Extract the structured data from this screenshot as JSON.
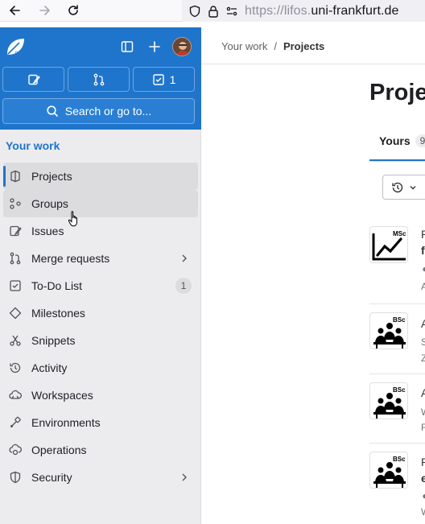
{
  "browser": {
    "url_prefix": "https://lifos.",
    "url_domain": "uni-frankfurt.de"
  },
  "sidebar": {
    "quick_actions": [
      {
        "name": "issues",
        "count": ""
      },
      {
        "name": "merge-requests",
        "count": ""
      },
      {
        "name": "todos",
        "count": "1"
      }
    ],
    "search_placeholder": "Search or go to...",
    "context_title": "Your work",
    "items": [
      {
        "label": "Projects",
        "icon": "project-icon",
        "active": true
      },
      {
        "label": "Groups",
        "icon": "group-icon",
        "hover": true
      },
      {
        "label": "Issues",
        "icon": "issues-icon"
      },
      {
        "label": "Merge requests",
        "icon": "merge-request-icon",
        "chevron": true
      },
      {
        "label": "To-Do List",
        "icon": "todo-icon",
        "count": "1"
      },
      {
        "label": "Milestones",
        "icon": "milestone-icon"
      },
      {
        "label": "Snippets",
        "icon": "snippet-icon"
      },
      {
        "label": "Activity",
        "icon": "history-icon"
      },
      {
        "label": "Workspaces",
        "icon": "workspace-icon"
      },
      {
        "label": "Environments",
        "icon": "environment-icon"
      },
      {
        "label": "Operations",
        "icon": "operations-icon"
      },
      {
        "label": "Security",
        "icon": "shield-icon",
        "chevron": true
      }
    ]
  },
  "main": {
    "breadcrumb": {
      "parent": "Your work",
      "separator": "/",
      "current": "Projects"
    },
    "title": "Proje",
    "tab": {
      "label": "Yours",
      "count": "9"
    },
    "projects": [
      {
        "badge": "MSc",
        "line1": "P",
        "line2": "f",
        "line3": "",
        "line4": "A"
      },
      {
        "badge": "BSc",
        "line1": "A",
        "line2": "S",
        "line3": "Z",
        "line4": ""
      },
      {
        "badge": "BSc",
        "line1": "A",
        "line2": "W",
        "line3": "F",
        "line4": ""
      },
      {
        "badge": "BSc",
        "line1": "P",
        "line2": "e",
        "line3": "",
        "line4": "W"
      }
    ]
  },
  "colors": {
    "brand": "#1f75cb",
    "sidebar_bg": "#ececef"
  }
}
